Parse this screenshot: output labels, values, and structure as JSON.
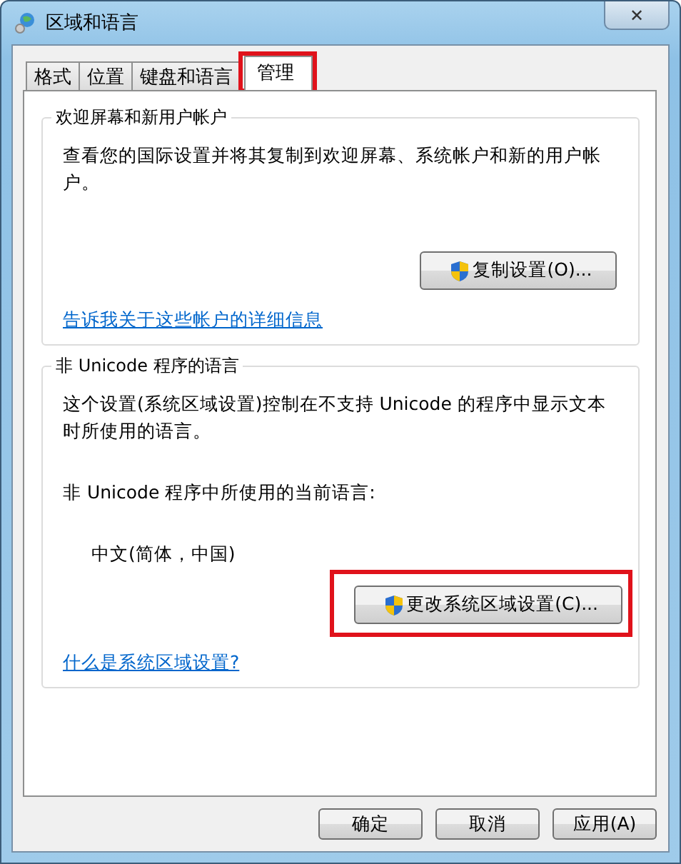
{
  "window": {
    "title": "区域和语言",
    "close": "✕"
  },
  "tabs": [
    {
      "label": "格式",
      "selected": false,
      "highlighted": false
    },
    {
      "label": "位置",
      "selected": false,
      "highlighted": false
    },
    {
      "label": "键盘和语言",
      "selected": false,
      "highlighted": false
    },
    {
      "label": "管理",
      "selected": true,
      "highlighted": true
    }
  ],
  "groups": [
    {
      "title": "欢迎屏幕和新用户帐户",
      "lines": [
        {
          "kind": "text",
          "text": "查看您的国际设置并将其复制到欢迎屏幕、系统帐户和新的用户帐户。"
        }
      ],
      "button": {
        "label": "复制设置(O)...",
        "highlighted": false
      },
      "link": "告诉我关于这些帐户的详细信息"
    },
    {
      "title": "非 Unicode 程序的语言",
      "lines": [
        {
          "kind": "text",
          "text": "这个设置(系统区域设置)控制在不支持 Unicode 的程序中显示文本时所使用的语言。"
        },
        {
          "kind": "text",
          "text": "非 Unicode 程序中所使用的当前语言:"
        },
        {
          "kind": "value",
          "text": "中文(简体，中国)"
        }
      ],
      "button": {
        "label": "更改系统区域设置(C)...",
        "highlighted": true
      },
      "link": "什么是系统区域设置?"
    }
  ],
  "buttons": [
    "确定",
    "取消",
    "应用(A)"
  ]
}
